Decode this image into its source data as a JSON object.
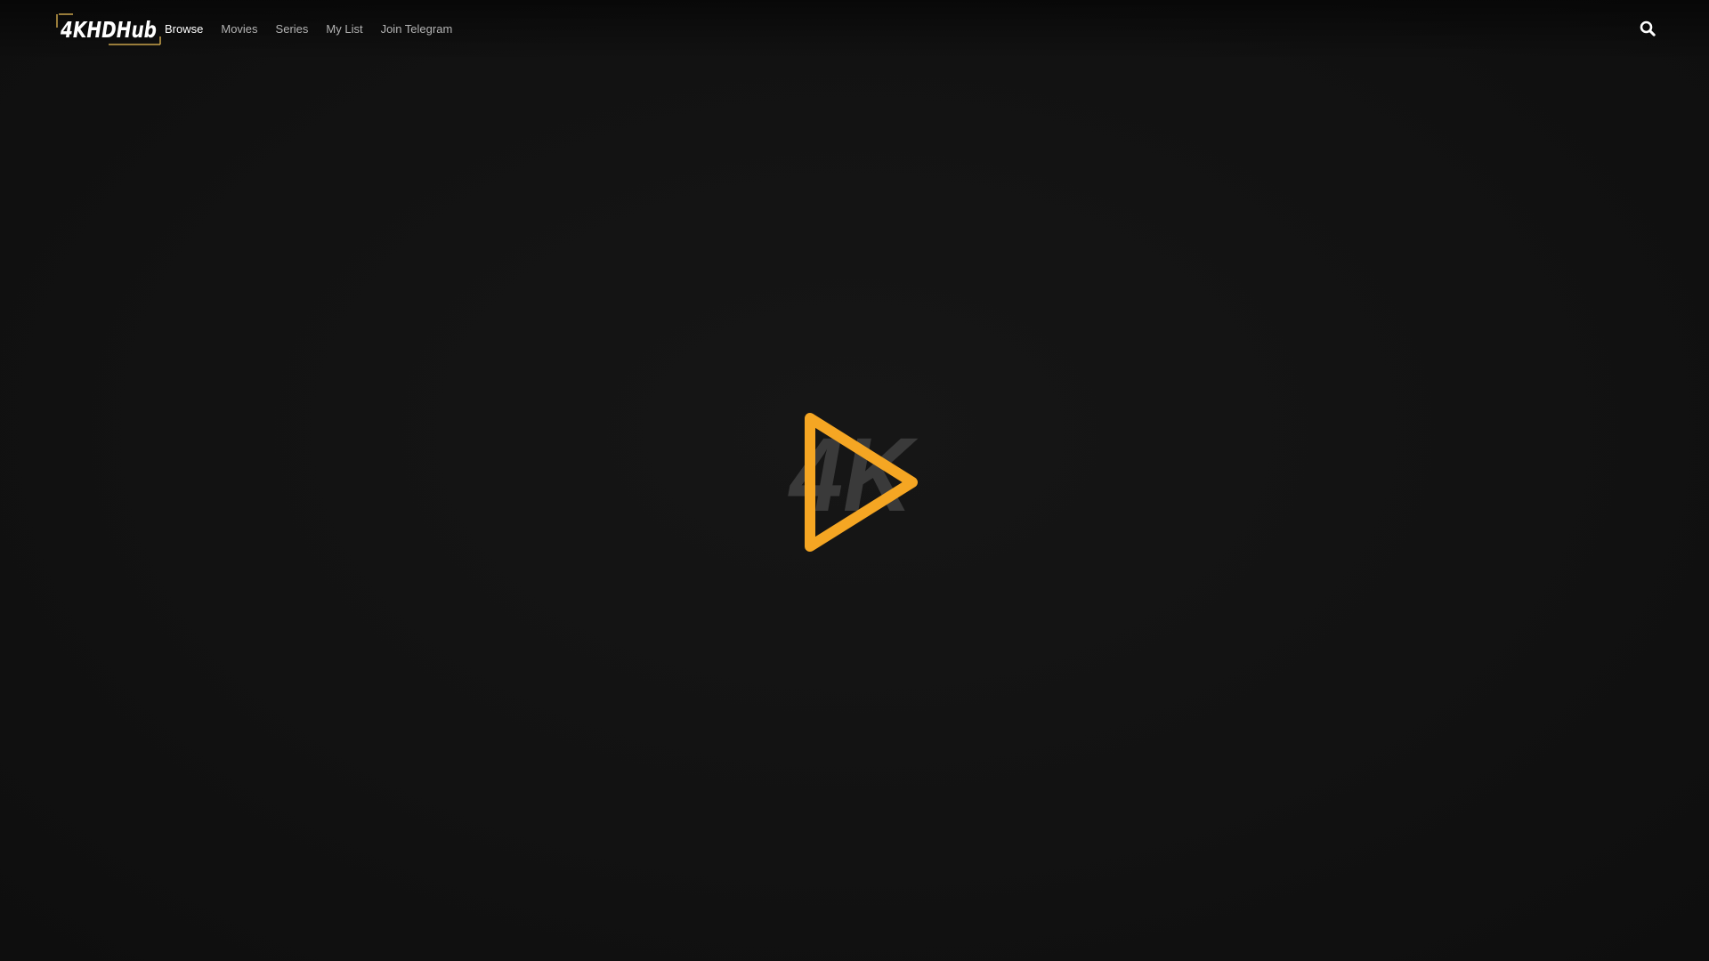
{
  "brand": {
    "logo_text": "4KHDHub",
    "accent_color": "#f5a623"
  },
  "nav": {
    "items": [
      {
        "label": "Browse",
        "active": true
      },
      {
        "label": "Movies",
        "active": false
      },
      {
        "label": "Series",
        "active": false
      },
      {
        "label": "My List",
        "active": false
      },
      {
        "label": "Join Telegram",
        "active": false
      }
    ]
  },
  "search": {
    "icon": "search-icon"
  },
  "loader": {
    "text": "4K",
    "icon": "play-triangle-icon",
    "text_color": "#3a3a3a",
    "triangle_color": "#f5a623"
  }
}
